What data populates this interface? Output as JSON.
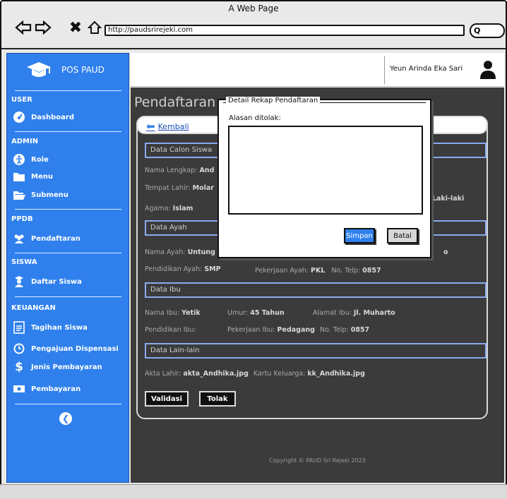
{
  "browser": {
    "title": "A Web Page",
    "url": "http://paudsrirejeki.com",
    "search_glyph": "Q"
  },
  "sidebar": {
    "brand": "POS PAUD",
    "sections": {
      "user": "USER",
      "admin": "ADMIN",
      "ppdb": "PPDB",
      "siswa": "SISWA",
      "keuangan": "KEUANGAN"
    },
    "items": [
      {
        "label": "Dashboard",
        "icon": "dashboard-icon"
      },
      {
        "label": "Role",
        "icon": "accessibility-icon"
      },
      {
        "label": "Menu",
        "icon": "folder-icon"
      },
      {
        "label": "Submenu",
        "icon": "folder-open-icon"
      },
      {
        "label": "Pendaftaran",
        "icon": "users-icon"
      },
      {
        "label": "Daftar Siswa",
        "icon": "student-icon"
      },
      {
        "label": "Tagihan Siswa",
        "icon": "document-icon"
      },
      {
        "label": "Pengajuan Dispensasi",
        "icon": "clock-icon"
      },
      {
        "label": "Jenis Pembayaran",
        "icon": "dollar-icon"
      },
      {
        "label": "Pembayaran",
        "icon": "cash-icon"
      }
    ]
  },
  "header": {
    "username": "Yeun Arinda Eka Sari"
  },
  "page": {
    "title": "Pendaftaran",
    "back": "Kembali",
    "sections": {
      "calon": "Data Calon Siswa",
      "ayah": "Data Ayah",
      "ibu": "Data Ibu",
      "lain": "Data Lain-lain"
    },
    "calon": {
      "nama_label": "Nama Lengkap: ",
      "nama_value": "And",
      "tempat_label": "Tempat Lahir: ",
      "tempat_value": "Molar",
      "jk_value": "Laki-laki",
      "agama_label": "Agama: ",
      "agama_value": "Islam"
    },
    "ayah": {
      "nama_label": "Nama Ayah: ",
      "nama_value": "Untung",
      "nama_tail": "o",
      "pendidikan_label": "Pendidikan Ayah: ",
      "pendidikan_value": "SMP",
      "pekerjaan_label": "Pekerjaan Ayah: ",
      "pekerjaan_value": "PKL",
      "telp_label": "No. Telp: ",
      "telp_value": "0857"
    },
    "ibu": {
      "nama_label": "Nama Ibu: ",
      "nama_value": "Yetik",
      "umur_label": "Umur: ",
      "umur_value": "45 Tahun",
      "alamat_label": "Alamat Ibu: ",
      "alamat_value": "Jl. Muharto",
      "pendidikan_label": "Pendidikan Ibu:",
      "pekerjaan_label": "Pekerjaan Ibu: ",
      "pekerjaan_value": "Pedagang",
      "telp_label": "No. Telp: ",
      "telp_value": "0857"
    },
    "lain": {
      "akta_label": "Akta Lahir: ",
      "akta_value": "akta_Andhika.jpg",
      "kk_label": "Kartu Keluarga: ",
      "kk_value": "kk_Andhika.jpg"
    },
    "validate": "Validasi",
    "reject": "Tolak",
    "footer": "Copyright © PAUD Sri Rejeki 2023"
  },
  "modal": {
    "title": "Detail Rekap Pendaftaran",
    "label": "Alasan ditolak:",
    "textarea_value": "",
    "save": "Simpan",
    "cancel": "Batal"
  },
  "colors": {
    "sidebar": "#2f80ed",
    "main": "#3b3b3b",
    "section_border": "#8aaaf0"
  }
}
